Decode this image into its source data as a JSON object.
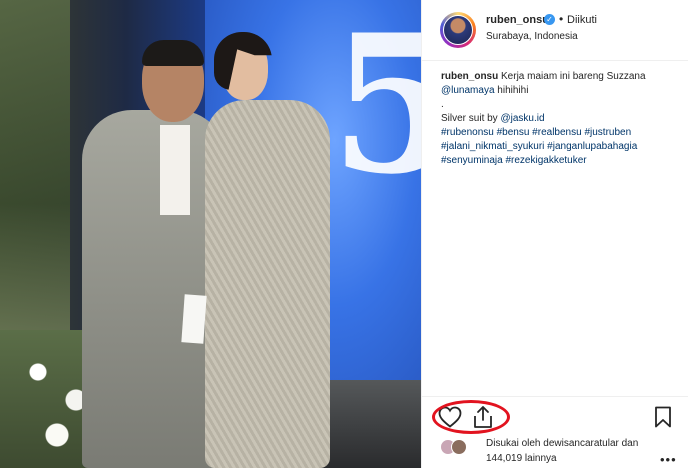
{
  "photo": {
    "screen_text": "5"
  },
  "post": {
    "username": "ruben_onsu",
    "follow_status": "Diikuti",
    "location": "Surabaya, Indonesia",
    "caption": {
      "author": "ruben_onsu",
      "text": "Kerja maiam ini bareng Suzzana",
      "mention": "@lunamaya",
      "laugh": "hihihihi",
      "dot": ".",
      "suit_credit_prefix": "Silver suit by",
      "suit_credit_mention": "@jasku.id",
      "hashtags_line1": "#rubenonsu #bensu #realbensu #justruben",
      "hashtags_line2": "#jalani_nikmati_syukuri #janganlupabahagia",
      "hashtags_line3": "#senyuminaja #rezekigakketuker"
    },
    "likes": {
      "line1": "Disukai oleh dewisancaratular dan",
      "line2": "144,019 lainnya"
    },
    "icons": {
      "verified": "verified-badge-icon",
      "like": "heart-icon",
      "share": "share-icon",
      "save": "bookmark-icon",
      "more": "more-options-icon"
    },
    "colors": {
      "link": "#003569",
      "verified": "#3897f0",
      "annotation": "#e2131f"
    }
  }
}
